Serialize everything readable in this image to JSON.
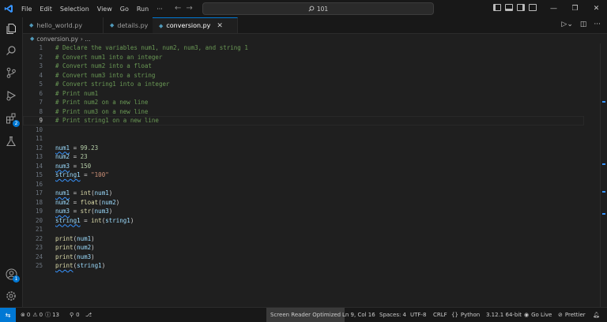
{
  "menu": [
    "File",
    "Edit",
    "Selection",
    "View",
    "Go",
    "Run",
    "···"
  ],
  "search": {
    "text": "101"
  },
  "tabs": [
    {
      "label": "hello_world.py"
    },
    {
      "label": "details.py"
    },
    {
      "label": "conversion.py",
      "close": "✕"
    }
  ],
  "breadcrumb": {
    "file": "conversion.py",
    "sep": "› ..."
  },
  "activity_badges": {
    "extensions": "2",
    "accounts": "1"
  },
  "lines": [
    {
      "n": "1",
      "text": "# Declare the variables num1, num2, num3, and string 1"
    },
    {
      "n": "2",
      "text": "# Convert num1 into an integer"
    },
    {
      "n": "3",
      "text": "# Convert num2 into a float"
    },
    {
      "n": "4",
      "text": "# Convert num3 into a string"
    },
    {
      "n": "5",
      "text": "# Convert string1 into a integer"
    },
    {
      "n": "6",
      "text": "# Print num1"
    },
    {
      "n": "7",
      "text": "# Print num2 on a new line"
    },
    {
      "n": "8",
      "text": "# Print num3 on a new line"
    },
    {
      "n": "9",
      "text": "# Print string1 on a new line"
    },
    {
      "n": "10"
    },
    {
      "n": "11"
    },
    {
      "n": "12",
      "var": "num1",
      "op": " = ",
      "val": "99.23"
    },
    {
      "n": "13",
      "var": "num2",
      "op": " = ",
      "val": "23"
    },
    {
      "n": "14",
      "var": "num3",
      "op": " = ",
      "val": "150"
    },
    {
      "n": "15",
      "var": "string1",
      "op": " = ",
      "val": "\"100\""
    },
    {
      "n": "16"
    },
    {
      "n": "17",
      "var": "num1",
      "op": " = ",
      "fn": "int",
      "open": "(",
      "arg": "num1",
      "close": ")"
    },
    {
      "n": "18",
      "var": "num2",
      "op": " = ",
      "fn": "float",
      "open": "(",
      "arg": "num2",
      "close": ")"
    },
    {
      "n": "19",
      "var": "num3",
      "op": " = ",
      "fn": "str",
      "open": "(",
      "arg": "num3",
      "close": ")"
    },
    {
      "n": "20",
      "var": "string1",
      "op": " = ",
      "fn": "int",
      "open": "(",
      "arg": "string1",
      "close": ")"
    },
    {
      "n": "21"
    },
    {
      "n": "22",
      "fn": "print",
      "open": "(",
      "arg": "num1",
      "close": ")"
    },
    {
      "n": "23",
      "fn": "print",
      "open": "(",
      "arg": "num2",
      "close": ")"
    },
    {
      "n": "24",
      "fn": "print",
      "open": "(",
      "arg": "num3",
      "close": ")"
    },
    {
      "n": "25",
      "fn": "print",
      "open": "(",
      "arg": "string1",
      "close": ")"
    }
  ],
  "status": {
    "errors": "0",
    "warnings": "0",
    "info": "13",
    "ports": "0",
    "screen_reader": "Screen Reader Optimized",
    "cursor": "Ln 9, Col 16",
    "spaces": "Spaces: 4",
    "encoding": "UTF-8",
    "eol": "CRLF",
    "language": "Python",
    "interpreter": "3.12.1 64-bit",
    "golive": "Go Live",
    "prettier": "Prettier"
  },
  "colors": {
    "accent": "#0078d4",
    "comment": "#6a9955",
    "variable": "#9cdcfe",
    "number": "#b5cea8",
    "string": "#ce9178",
    "function": "#dcdcaa"
  }
}
